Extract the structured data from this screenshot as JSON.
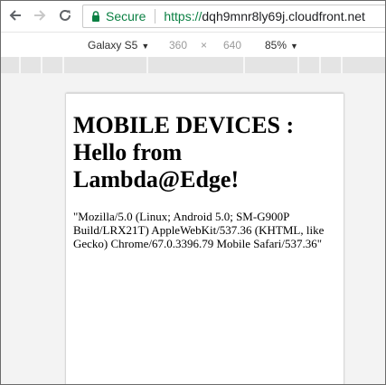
{
  "address_bar": {
    "secure_label": "Secure",
    "url_scheme": "https://",
    "url_host": "dqh9mnr8ly69j.cloudfront.net"
  },
  "device_toolbar": {
    "device_name": "Galaxy S5",
    "width": "360",
    "separator": "×",
    "height": "640",
    "zoom": "85%"
  },
  "page": {
    "heading": "MOBILE DEVICES : Hello from Lambda@Edge!",
    "user_agent": "\"Mozilla/5.0 (Linux; Android 5.0; SM-G900P Build/LRX21T) AppleWebKit/537.36 (KHTML, like Gecko) Chrome/67.0.3396.79 Mobile Safari/537.36\""
  },
  "colors": {
    "secure_green": "#0b8043"
  }
}
